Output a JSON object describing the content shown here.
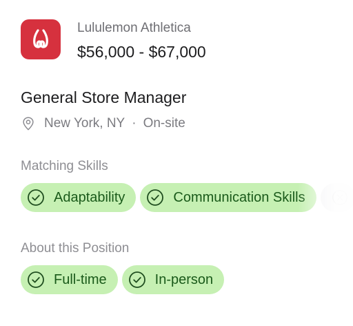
{
  "company": {
    "name": "Lululemon Athletica",
    "salary": "$56,000 - $67,000",
    "logo_icon": "lululemon-logo-icon",
    "brand_color": "#d6313e"
  },
  "job": {
    "title": "General Store Manager",
    "location": "New York, NY",
    "separator": "·",
    "work_mode": "On-site",
    "location_icon": "location-pin-icon"
  },
  "matching_skills": {
    "label": "Matching Skills",
    "items": [
      {
        "label": "Adaptability",
        "icon": "check-circle-icon"
      },
      {
        "label": "Communication Skills",
        "icon": "check-circle-icon"
      }
    ],
    "overflow_icon": "close-circle-icon",
    "chip_color": "#c6f0b3"
  },
  "about_position": {
    "label": "About this Position",
    "items": [
      {
        "label": "Full-time",
        "icon": "check-circle-icon"
      },
      {
        "label": "In-person",
        "icon": "check-circle-icon"
      }
    ]
  }
}
